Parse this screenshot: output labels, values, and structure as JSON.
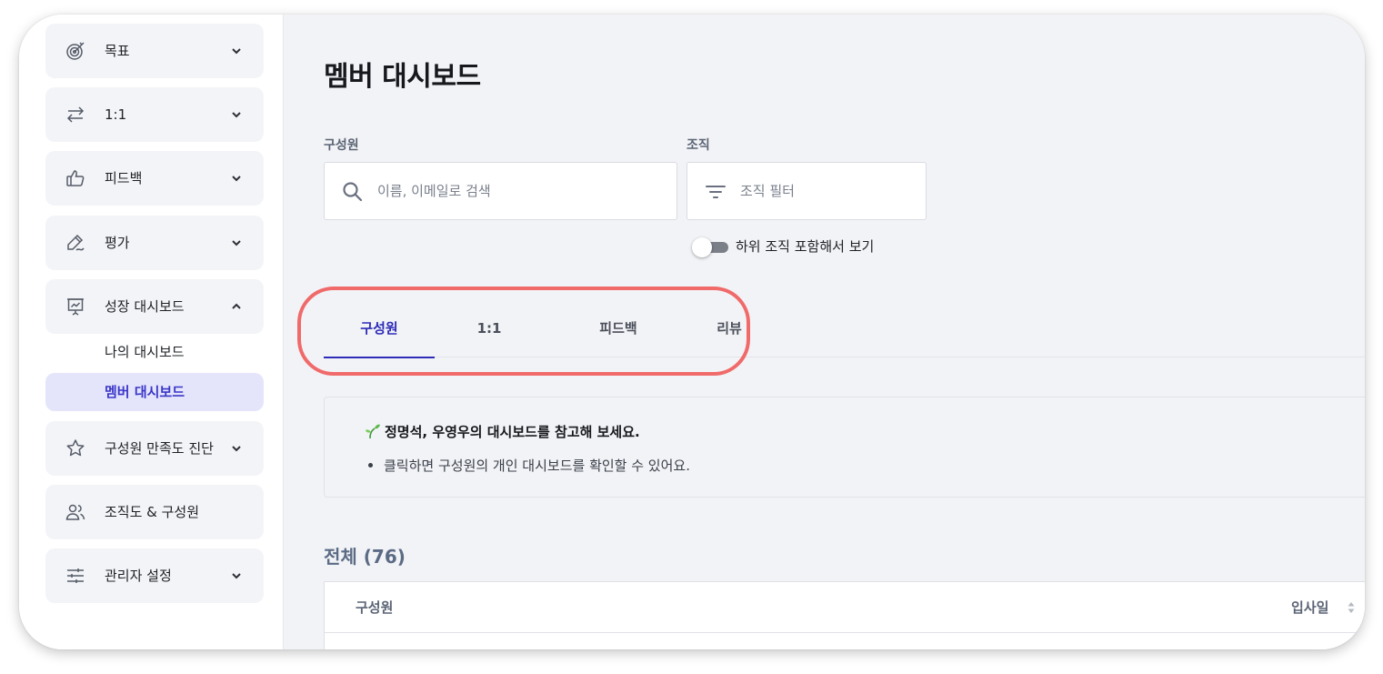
{
  "sidebar": {
    "items": [
      {
        "label": "목표",
        "icon": "target-icon",
        "chevron": "down"
      },
      {
        "label": "1:1",
        "icon": "exchange-arrows-icon",
        "chevron": "down"
      },
      {
        "label": "피드백",
        "icon": "thumbs-up-icon",
        "chevron": "down"
      },
      {
        "label": "평가",
        "icon": "pen-signature-icon",
        "chevron": "down"
      },
      {
        "label": "성장 대시보드",
        "icon": "presentation-chart-icon",
        "chevron": "up"
      },
      {
        "label": "구성원 만족도 진단",
        "icon": "star-icon",
        "chevron": "down"
      },
      {
        "label": "조직도 & 구성원",
        "icon": "people-icon",
        "chevron": "none"
      },
      {
        "label": "관리자 설정",
        "icon": "sliders-icon",
        "chevron": "down"
      }
    ],
    "subitems": [
      {
        "label": "나의 대시보드",
        "active": false
      },
      {
        "label": "멤버 대시보드",
        "active": true
      }
    ]
  },
  "main": {
    "title": "멤버 대시보드",
    "member_label": "구성원",
    "member_placeholder": "이름, 이메일로 검색",
    "org_label": "조직",
    "org_placeholder": "조직 필터",
    "toggle_label": "하위 조직 포함해서 보기",
    "toggle_on": false,
    "tabs": [
      {
        "label": "구성원",
        "active": true
      },
      {
        "label": "1:1",
        "active": false
      },
      {
        "label": "피드백",
        "active": false
      },
      {
        "label": "리뷰",
        "active": false
      }
    ],
    "notice": {
      "title": "정명석, 우영우의 대시보드를 참고해 보세요.",
      "bullet": "클릭하면 구성원의 개인 대시보드를 확인할 수 있어요."
    },
    "total": "전체 (76)",
    "table": {
      "col_member": "구성원",
      "col_join_date": "입사일"
    }
  },
  "colors": {
    "accent": "#2e2bb8",
    "active_bg": "#e4e5fb",
    "highlight_ring": "#f06a6a"
  }
}
